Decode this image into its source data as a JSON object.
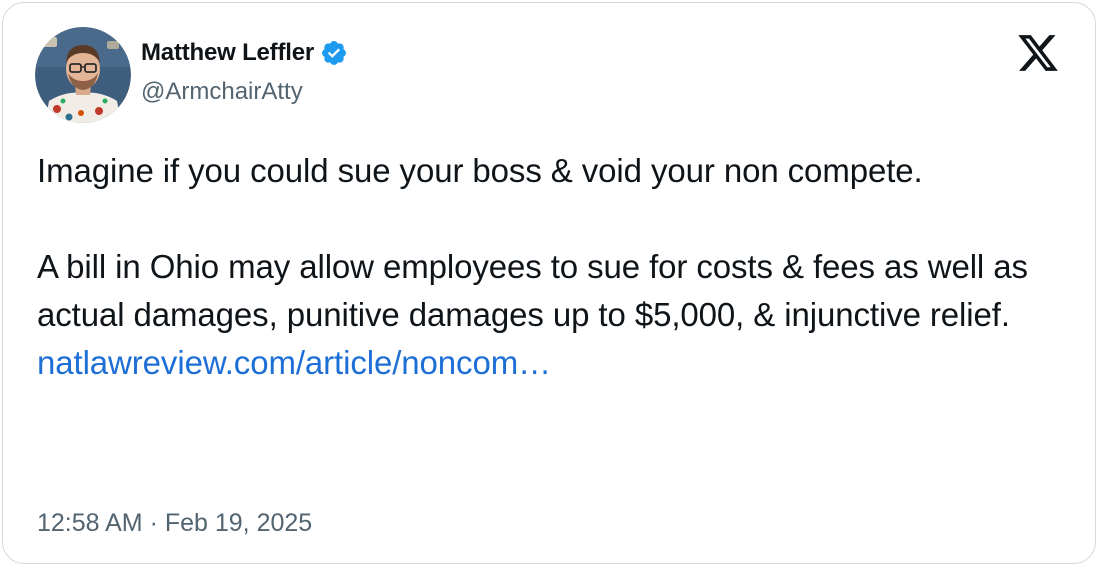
{
  "author": {
    "display_name": "Matthew Leffler",
    "handle": "@ArmchairAtty",
    "verified": true,
    "verified_icon": "verified-badge-icon",
    "avatar_icon": "profile-photo-avatar"
  },
  "brand": {
    "logo_icon": "x-logo-icon"
  },
  "tweet": {
    "paragraph_1": "Imagine if you could sue your boss & void your non compete.",
    "paragraph_2": "A bill in Ohio may allow employees to sue for costs & fees as well as actual damages, punitive damages up to $5,000, & injunctive relief.",
    "link_text": "natlawreview.com/article/noncom…",
    "timestamp": "12:58 AM · Feb 19, 2025"
  },
  "colors": {
    "link": "#1d6fd6",
    "verified": "#1d9bf0",
    "muted_text": "#536471",
    "border": "#cfd9de"
  }
}
